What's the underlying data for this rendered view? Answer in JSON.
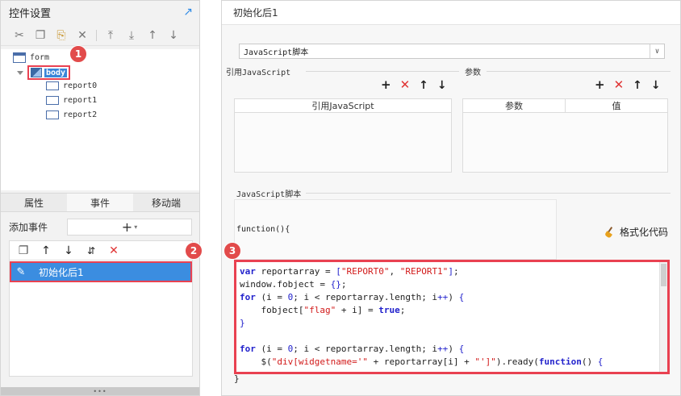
{
  "left_panel": {
    "title": "控件设置",
    "toolbar": [
      "cut-icon",
      "copy-icon",
      "paste-icon",
      "delete-icon",
      "move-top-icon",
      "move-bottom-icon",
      "move-up-icon",
      "move-down-icon"
    ],
    "tree": {
      "root": "form",
      "selected": "body",
      "children": [
        "report0",
        "report1",
        "report2"
      ]
    },
    "tabs": [
      {
        "label": "属性",
        "active": false
      },
      {
        "label": "事件",
        "active": true
      },
      {
        "label": "移动端",
        "active": false
      }
    ],
    "add_event_label": "添加事件",
    "add_event_button": "+",
    "event_item": "初始化后1",
    "badges": [
      "1",
      "2"
    ]
  },
  "right_panel": {
    "title": "初始化后1",
    "script_type": "JavaScript脚本",
    "ref_js_label": "引用JavaScript",
    "params_label": "参数",
    "ref_js_column": "引用JavaScript",
    "param_columns": [
      "参数",
      "值"
    ],
    "script_section_label": "JavaScript脚本",
    "function_header": "function(){",
    "format_button": "格式化代码",
    "badge": "3",
    "code_lines": [
      "var reportarray = [\"REPORT0\", \"REPORT1\"];",
      "window.fobject = {};",
      "for (i = 0; i < reportarray.length; i++) {",
      "    fobject[\"flag\" + i] = true;",
      "}",
      "",
      "for (i = 0; i < reportarray.length; i++) {",
      "    $(\"div[widgetname='\" + reportarray[i] + \"']\").ready(function() {"
    ],
    "closing_brace": "}"
  },
  "colors": {
    "highlight_red": "#e94151",
    "selection_blue": "#3b8de0",
    "keyword_blue": "#2222cc",
    "string_red": "#d21a1a"
  }
}
